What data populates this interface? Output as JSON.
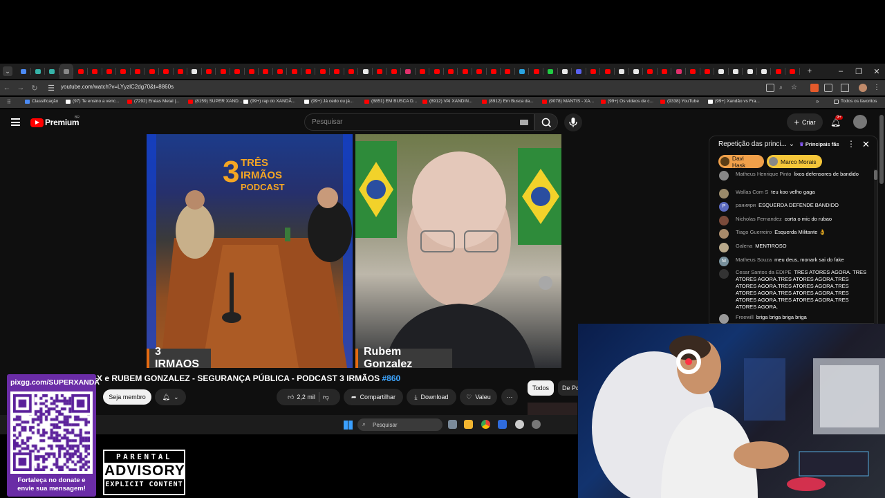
{
  "browser": {
    "url": "youtube.com/watch?v=LYyzlC2dg70&t=8860s",
    "bookmarks": [
      {
        "label": "Classificação",
        "color": "#4c8bf5"
      },
      {
        "label": "(97) Te ensino a venc...",
        "color": "#ffffff"
      },
      {
        "label": "(7292) Enéas Metal |...",
        "color": "#ff0000"
      },
      {
        "label": "(8159) SUPER XAND...",
        "color": "#ff0000"
      },
      {
        "label": "(99+) rap do XANDÃ...",
        "color": "#ffffff"
      },
      {
        "label": "(99+) Já cedo ou já...",
        "color": "#ffffff"
      },
      {
        "label": "(8851) EM BUSCA D...",
        "color": "#ff0000"
      },
      {
        "label": "(8912) VAI XANDIN...",
        "color": "#ff0000"
      },
      {
        "label": "(8912) Em Busca da...",
        "color": "#ff0000"
      },
      {
        "label": "(9078) MANTIS - XA...",
        "color": "#ff0000"
      },
      {
        "label": "(99+) Os vídeos de c...",
        "color": "#ff0000"
      },
      {
        "label": "(9338) YouTube",
        "color": "#ff0000"
      },
      {
        "label": "(99+) Xandão vs Fra...",
        "color": "#ffffff"
      }
    ],
    "all_bookmarks": "Todos os favoritos"
  },
  "youtube": {
    "brand": "Premium",
    "country": "BR",
    "search_placeholder": "Pesquisar",
    "create_label": "Criar",
    "notif_badge": "9+"
  },
  "video": {
    "left_name": "3 IRMAOS",
    "right_name": "Rubem Gonzalez",
    "logo_line1": "TRÊS",
    "logo_line2": "IRMÃOS",
    "logo_line3": "PODCAST",
    "logo_number": "3",
    "title": "X e RUBEM GONZALEZ - SEGURANÇA PÚBLICA - PODCAST 3 IRMÃOS",
    "title_tag": "#860",
    "member_label": "Seja membro",
    "likes": "2,2 mil",
    "share_label": "Compartilhar",
    "download_label": "Download",
    "thanks_label": "Valeu",
    "chip_all": "Todos",
    "chip_other": "De Po"
  },
  "taskbar": {
    "search_placeholder": "Pesquisar"
  },
  "chat": {
    "header": "Repetição das princi...",
    "filter": "Principais fãs",
    "donors": [
      "Davi Hask",
      "Marco Morais"
    ],
    "messages": [
      {
        "author": "Matheus Henrique Pinto",
        "text": "lixos defensores de bandido",
        "avatar": "#888888"
      },
      {
        "author": "Wallas Com S",
        "text": "teu koo velho gaga",
        "avatar": "#9a8a6a"
      },
      {
        "author": "ранияри",
        "text": "ESQUERDA DEFENDE BANDIDO",
        "avatar": "#5c6bc0",
        "initial": "P"
      },
      {
        "author": "Nicholas Fernandez",
        "text": "corta o mic do rubao",
        "avatar": "#7a4a3a"
      },
      {
        "author": "Tiago Guerreiro",
        "text": "Esquerda Militante 👌",
        "avatar": "#a88a6a"
      },
      {
        "author": "Galena",
        "text": "MENTIROSO",
        "avatar": "#b8a88a"
      },
      {
        "author": "Matheus Souza",
        "text": "meu deus, monark sai do fake",
        "avatar": "#78909c",
        "initial": "M"
      },
      {
        "author": "Cesar Santos da EDIPE",
        "text": "TRES ATORES AGORA. TRES ATORES AGORA.TRES ATORES AGORA.TRES ATORES AGORA.TRES ATORES AGORA.TRES ATORES AGORA.TRES ATORES AGORA.TRES ATORES AGORA.TRES ATORES AGORA.TRES ATORES AGORA.",
        "avatar": "#333333"
      },
      {
        "author": "Freewill",
        "text": "briga briga briga briga",
        "avatar": "#999999"
      }
    ]
  },
  "overlay": {
    "pix_url": "pixgg.com/SUPERXANDÃ",
    "pix_message": "Fortaleça no donate e envie sua mensagem!",
    "advisory_top": "PARENTAL",
    "advisory_mid": "ADVISORY",
    "advisory_bottom": "EXPLICIT CONTENT"
  }
}
